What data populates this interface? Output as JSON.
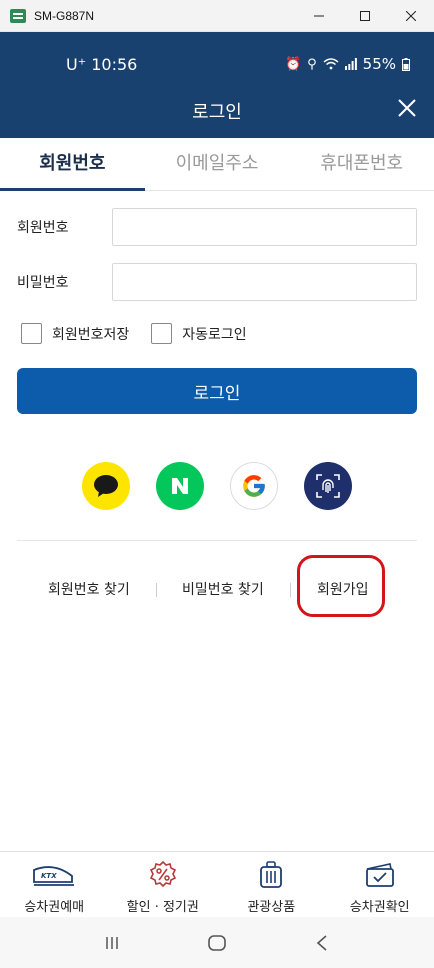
{
  "window": {
    "title": "SM-G887N"
  },
  "status": {
    "carrier": "U⁺",
    "time": "10:56",
    "battery": "55%"
  },
  "header": {
    "title": "로그인"
  },
  "tabs": [
    {
      "label": "회원번호"
    },
    {
      "label": "이메일주소"
    },
    {
      "label": "휴대폰번호"
    }
  ],
  "form": {
    "member_label": "회원번호",
    "member_value": "",
    "password_label": "비밀번호",
    "password_value": "",
    "save_member": "회원번호저장",
    "auto_login": "자동로그인",
    "login_button": "로그인"
  },
  "links": {
    "find_member": "회원번호 찾기",
    "find_password": "비밀번호 찾기",
    "signup": "회원가입"
  },
  "bottom_nav": [
    {
      "label": "승차권예매",
      "icon": "ktx-train-icon"
    },
    {
      "label": "할인 · 정기권",
      "icon": "discount-icon"
    },
    {
      "label": "관광상품",
      "icon": "luggage-icon"
    },
    {
      "label": "승차권확인",
      "icon": "ticket-check-icon"
    }
  ],
  "colors": {
    "header": "#19416f",
    "primary": "#0d5cab",
    "highlight": "#d3141a",
    "kakao": "#fee500",
    "naver": "#03c75a"
  }
}
